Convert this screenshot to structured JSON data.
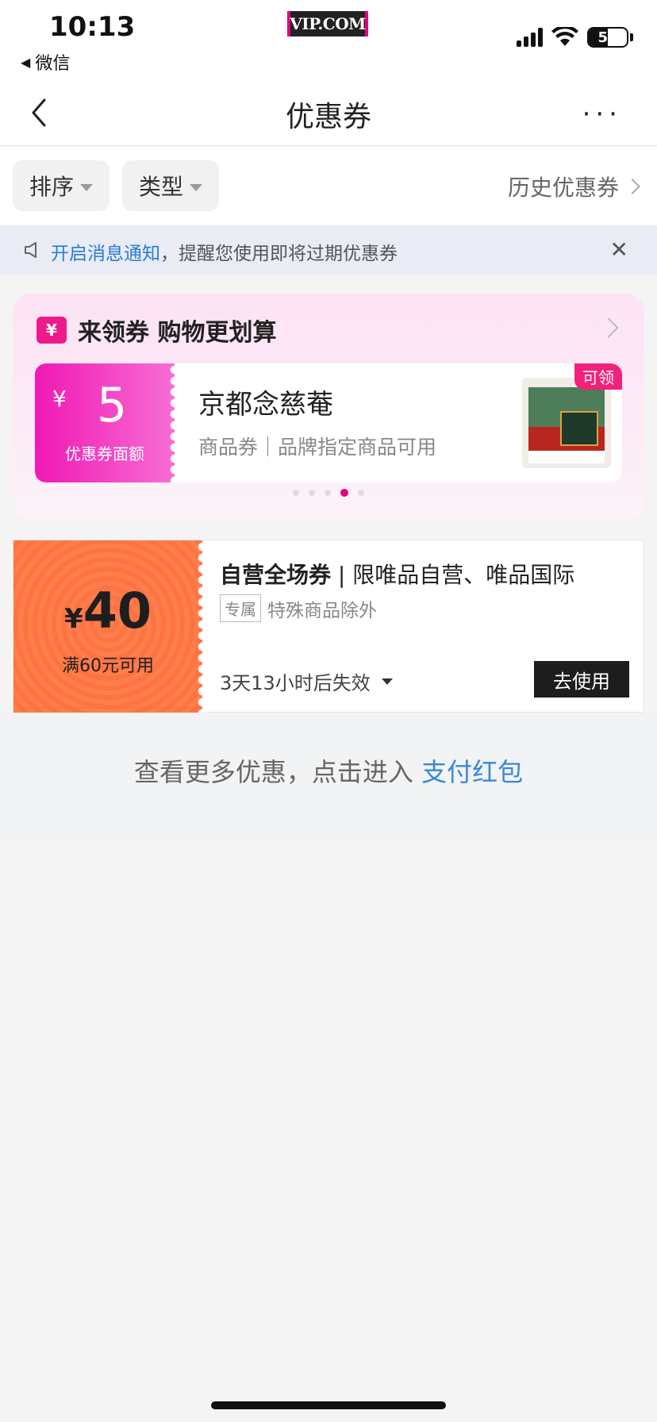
{
  "status": {
    "time": "10:13",
    "back_app": "微信",
    "logo": "VIP.COM",
    "battery": "50",
    "battery_level": 0.5
  },
  "nav": {
    "title": "优惠券",
    "more": "···"
  },
  "filters": {
    "sort": "排序",
    "type": "类型",
    "history": "历史优惠券"
  },
  "notice": {
    "link": "开启消息通知",
    "text": "，提醒您使用即将过期优惠券",
    "close": "✕"
  },
  "promo": {
    "title": "来领券 购物更划算",
    "coupon": {
      "currency": "¥",
      "amount": "5",
      "label": "优惠券面额",
      "shop": "京都念慈菴",
      "desc": "商品券｜品牌指定商品可用",
      "badge": "可领"
    },
    "page_count": 5,
    "active_page": 4
  },
  "coupon": {
    "currency": "¥",
    "amount": "40",
    "condition": "满60元可用",
    "title_bold": "自营全场券",
    "title_rest": " | 限唯品自营、唯品国际",
    "tag": "专属",
    "tag_text": "特殊商品除外",
    "expire": "3天13小时后失效",
    "button": "去使用"
  },
  "more": {
    "text": "查看更多优惠，点击进入 ",
    "link": "支付红包"
  },
  "colors": {
    "accent": "#e4007f",
    "link": "#2a7bd6",
    "coupon_orange": "#ff7e4b"
  }
}
